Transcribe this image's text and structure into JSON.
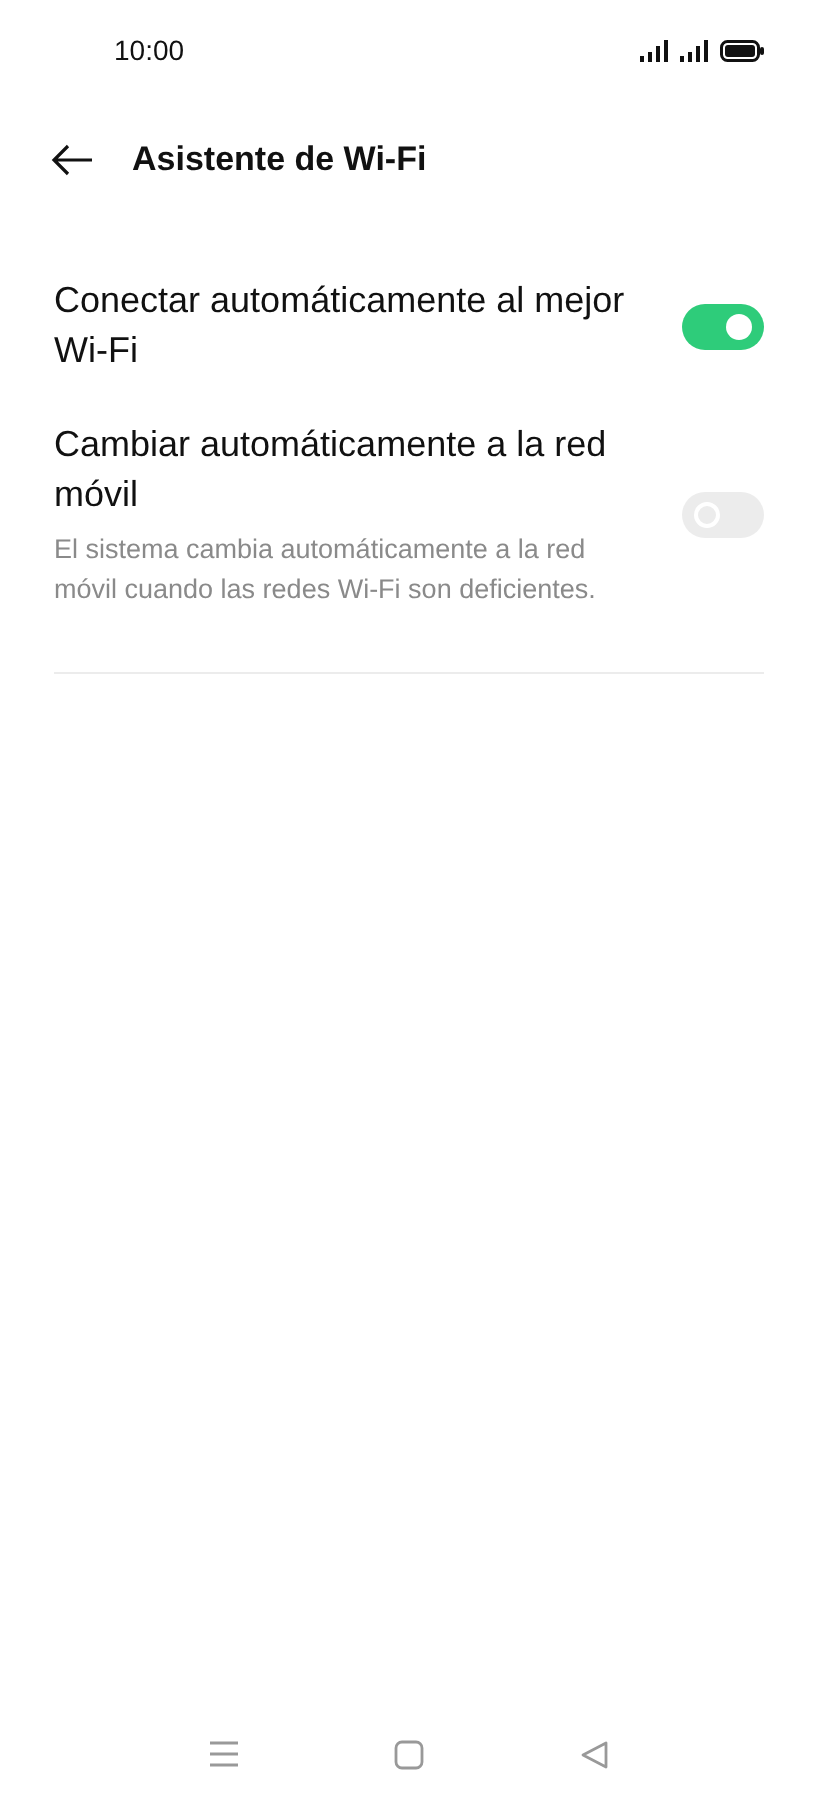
{
  "status_bar": {
    "time": "10:00"
  },
  "header": {
    "title": "Asistente de Wi-Fi"
  },
  "settings": [
    {
      "title": "Conectar automáticamente al mejor Wi-Fi",
      "on": true
    },
    {
      "title": "Cambiar automáticamente a la red móvil",
      "description": "El sistema cambia automáticamente a la red móvil cuando las redes Wi-Fi son deficientes.",
      "on": false
    }
  ]
}
